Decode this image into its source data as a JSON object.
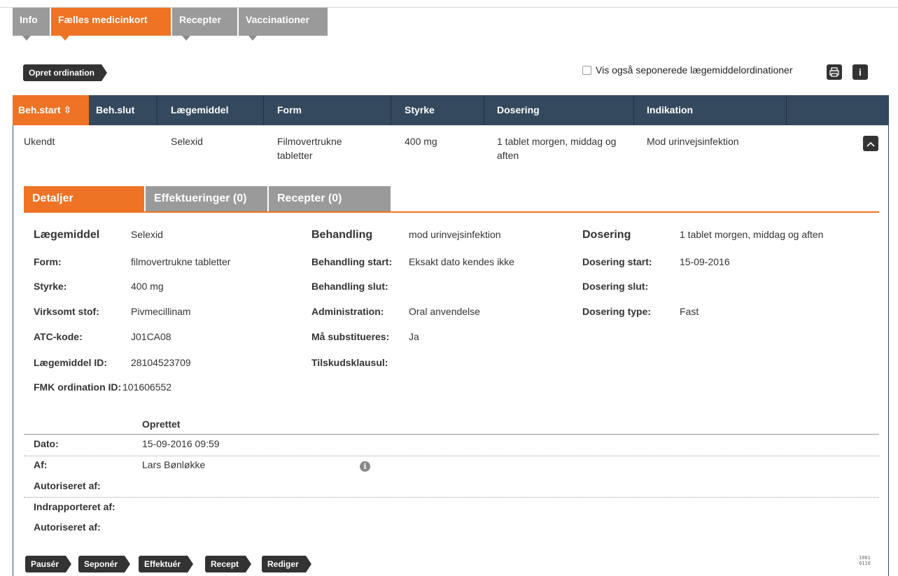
{
  "top_tabs": [
    {
      "label": "Info",
      "active": false
    },
    {
      "label": "Fælles medicinkort",
      "active": true
    },
    {
      "label": "Recepter",
      "active": false
    },
    {
      "label": "Vaccinationer",
      "active": false
    }
  ],
  "toolbar": {
    "create_label": "Opret ordination",
    "show_discontinued_label": "Vis også seponerede lægemiddelordinationer",
    "print_icon": "printer-icon",
    "info_icon": "info-icon",
    "info_glyph": "i"
  },
  "table": {
    "sort_arrow": "⇳",
    "headers": {
      "beh_start": "Beh.start",
      "beh_slut": "Beh.slut",
      "laegemiddel": "Lægemiddel",
      "form": "Form",
      "styrke": "Styrke",
      "dosering": "Dosering",
      "indikation": "Indikation"
    },
    "row": {
      "beh_start": "Ukendt",
      "beh_slut": "",
      "laegemiddel": "Selexid",
      "form": "Filmovertrukne tabletter",
      "styrke": "400 mg",
      "dosering": "1 tablet morgen, middag og aften",
      "indikation": "Mod urinvejsinfektion"
    }
  },
  "subtabs": {
    "detaljer": "Detaljer",
    "effektueringer": "Effektueringer (0)",
    "recepter": "Recepter (0)"
  },
  "details": {
    "col1": {
      "laegemiddel_label": "Lægemiddel",
      "laegemiddel_value": "Selexid",
      "form_label": "Form:",
      "form_value": "filmovertrukne tabletter",
      "styrke_label": "Styrke:",
      "styrke_value": "400 mg",
      "virksomt_label": "Virksomt stof:",
      "virksomt_value": "Pivmecillinam",
      "atc_label": "ATC-kode:",
      "atc_value": "J01CA08",
      "id_label": "Lægemiddel ID:",
      "id_value": "28104523709",
      "fmk_label": "FMK ordination ID:",
      "fmk_value": "101606552"
    },
    "col2": {
      "behandling_label": "Behandling",
      "behandling_value": "mod urinvejsinfektion",
      "start_label": "Behandling start:",
      "start_value": "Eksakt dato kendes ikke",
      "slut_label": "Behandling slut:",
      "slut_value": "",
      "admin_label": "Administration:",
      "admin_value": "Oral anvendelse",
      "subst_label": "Må substitueres:",
      "subst_value": "Ja",
      "tilskud_label": "Tilskudsklausul:",
      "tilskud_value": ""
    },
    "col3": {
      "dosering_label": "Dosering",
      "dosering_value": "1 tablet morgen, middag og aften",
      "start_label": "Dosering start:",
      "start_value": "15-09-2016",
      "slut_label": "Dosering slut:",
      "slut_value": "",
      "type_label": "Dosering type:",
      "type_value": "Fast"
    }
  },
  "audit": {
    "oprettet_label": "Oprettet",
    "dato_label": "Dato:",
    "dato_value": "15-09-2016 09:59",
    "af_label": "Af:",
    "af_value": "Lars Bønløkke",
    "autoriseret_label_1": "Autoriseret af:",
    "indrapporteret_label": "Indrapporteret af:",
    "autoriseret_label_2": "Autoriseret af:",
    "info_glyph": "i"
  },
  "actions": {
    "pause": "Pausér",
    "seponer": "Seponér",
    "effektuer": "Effektuér",
    "recept": "Recept",
    "rediger": "Rediger"
  },
  "binary_badge": {
    "line1": "1001",
    "line2": "0110"
  },
  "colors": {
    "accent": "#ee7325",
    "header": "#34495e",
    "dark_button": "#333333",
    "tab_gray": "#9a9a9a"
  }
}
